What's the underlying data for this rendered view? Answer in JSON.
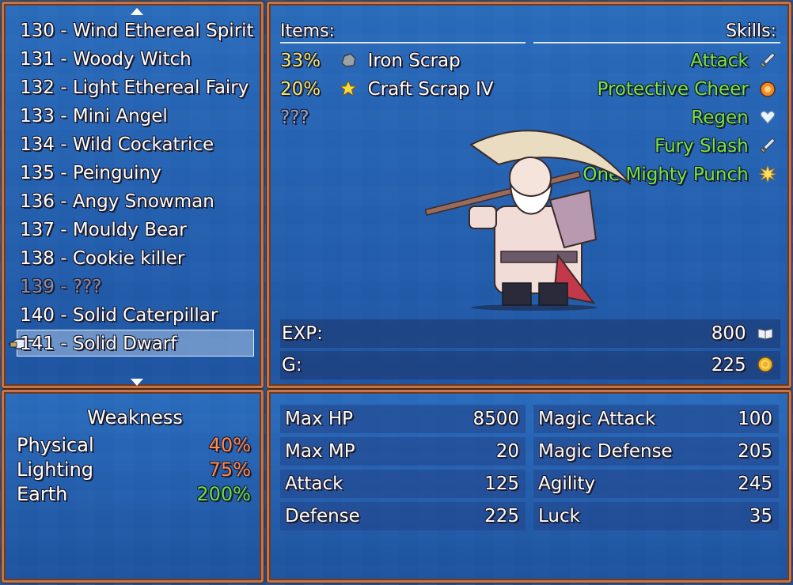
{
  "monster_list": {
    "items": [
      {
        "label": "130 - Wind Ethereal Spirit",
        "known": true
      },
      {
        "label": "131 - Woody Witch",
        "known": true
      },
      {
        "label": "132 - Light Ethereal Fairy",
        "known": true
      },
      {
        "label": "133 - Mini Angel",
        "known": true
      },
      {
        "label": "134 - Wild Cockatrice",
        "known": true
      },
      {
        "label": "135 - Peinguiny",
        "known": true
      },
      {
        "label": "136 - Angy Snowman",
        "known": true
      },
      {
        "label": "137 - Mouldy Bear",
        "known": true
      },
      {
        "label": "138 - Cookie killer",
        "known": true
      },
      {
        "label": "139 - ???",
        "known": false
      },
      {
        "label": "140 - Solid Caterpillar",
        "known": true
      },
      {
        "label": "141 - Solid Dwarf",
        "known": true,
        "selected": true
      }
    ]
  },
  "weakness": {
    "title": "Weakness",
    "rows": [
      {
        "label": "Physical",
        "value": "40%",
        "color": "#ff8a50"
      },
      {
        "label": "Lighting",
        "value": "75%",
        "color": "#ff8a50"
      },
      {
        "label": "Earth",
        "value": "200%",
        "color": "#63e04a"
      }
    ]
  },
  "info": {
    "items_header": "Items:",
    "skills_header": "Skills:",
    "items": [
      {
        "chance": "33%",
        "name": "Iron Scrap",
        "icon": "rock-icon"
      },
      {
        "chance": "20%",
        "name": "Craft Scrap IV",
        "icon": "star-icon"
      },
      {
        "chance": "",
        "name": "???",
        "icon": ""
      }
    ],
    "skills": [
      {
        "name": "Attack",
        "icon": "sword-icon"
      },
      {
        "name": "Protective Cheer",
        "icon": "shield-icon"
      },
      {
        "name": "Regen",
        "icon": "heart-icon"
      },
      {
        "name": "Fury Slash",
        "icon": "sword-icon"
      },
      {
        "name": "One Mighty Punch",
        "icon": "burst-icon"
      }
    ],
    "exp_label": "EXP:",
    "exp_value": "800",
    "gold_label": "G:",
    "gold_value": "225"
  },
  "stats": {
    "max_hp_label": "Max HP",
    "max_hp": "8500",
    "max_mp_label": "Max MP",
    "max_mp": "20",
    "attack_label": "Attack",
    "attack": "125",
    "defense_label": "Defense",
    "defense": "225",
    "magic_attack_label": "Magic Attack",
    "magic_attack": "100",
    "magic_defense_label": "Magic Defense",
    "magic_defense": "205",
    "agility_label": "Agility",
    "agility": "245",
    "luck_label": "Luck",
    "luck": "35"
  },
  "colors": {
    "window_border": "#c4764b",
    "skill_text": "#6fe84a",
    "item_percent": "#f0e878"
  }
}
